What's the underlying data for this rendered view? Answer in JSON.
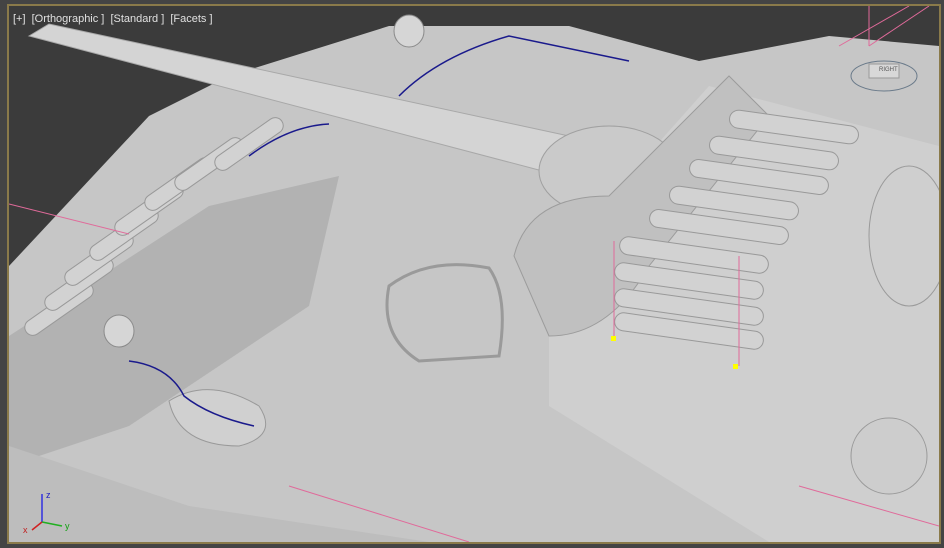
{
  "viewport": {
    "labels": [
      "[+]",
      "[Orthographic ]",
      "[Standard ]",
      "[Facets ]"
    ],
    "viewcube_face": "RIGHT",
    "axes": {
      "x": "x",
      "y": "y",
      "z": "z"
    },
    "colors": {
      "border_active": "#8a7a4a",
      "background": "#3b3b3b",
      "model": "#c8c8c8",
      "spline": "#1a1a8c",
      "helper": "#e06a9a"
    }
  }
}
